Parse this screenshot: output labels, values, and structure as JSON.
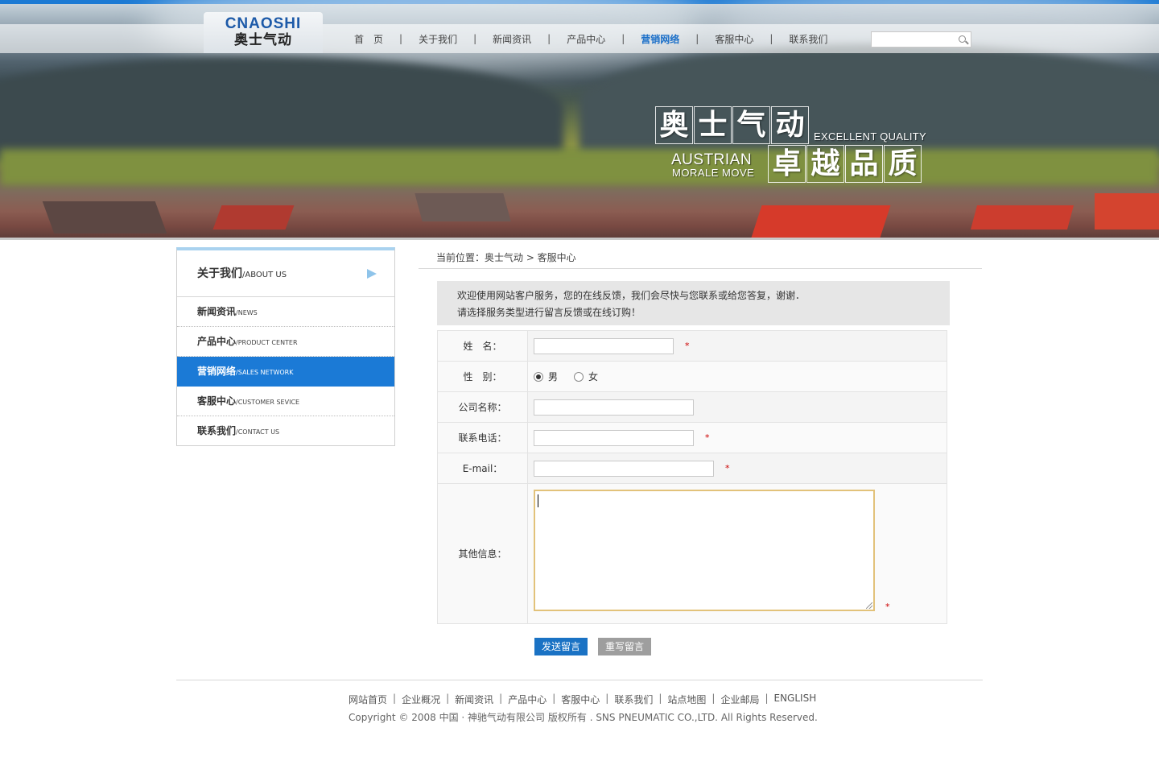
{
  "header": {
    "logo_en": "CNAOSHI",
    "logo_cn": "奥士气动",
    "nav": [
      {
        "label": "首　页",
        "active": false
      },
      {
        "label": "关于我们",
        "active": false
      },
      {
        "label": "新闻资讯",
        "active": false
      },
      {
        "label": "产品中心",
        "active": false
      },
      {
        "label": "营销网络",
        "active": true
      },
      {
        "label": "客服中心",
        "active": false
      },
      {
        "label": "联系我们",
        "active": false
      }
    ],
    "nav_separator": "|",
    "search_value": "",
    "search_icon": "search-icon",
    "accent_color": "#1b7ad6"
  },
  "banner": {
    "slogan_cn_1": [
      "奥",
      "士",
      "气",
      "动"
    ],
    "slogan_cn_2": [
      "卓",
      "越",
      "品",
      "质"
    ],
    "slogan_en_1": "EXCELLENT QUALITY",
    "slogan_en_2": "AUSTRIAN",
    "slogan_en_3": "MORALE MOVE"
  },
  "sidebar": {
    "title_cn": "关于我们",
    "title_en": "/ABOUT US",
    "items": [
      {
        "cn": "新闻资讯",
        "en": "/NEWS",
        "active": false
      },
      {
        "cn": "产品中心",
        "en": "/PRODUCT CENTER",
        "active": false
      },
      {
        "cn": "营销网络",
        "en": "/SALES NETWORK",
        "active": true
      },
      {
        "cn": "客服中心",
        "en": "/CUSTOMER SEVICE",
        "active": false
      },
      {
        "cn": "联系我们",
        "en": "/CONTACT US",
        "active": false
      }
    ]
  },
  "main": {
    "breadcrumb": "当前位置：奥士气动 > 客服中心",
    "notice_line1": "欢迎使用网站客户服务，您的在线反馈，我们会尽快与您联系或给您答复，谢谢．",
    "notice_line2": "请选择服务类型进行留言反馈或在线订购！",
    "form": {
      "name_label": "姓　名：",
      "name_value": "",
      "gender_label": "性　别：",
      "gender_male": "男",
      "gender_female": "女",
      "gender_selected": "男",
      "company_label": "公司名称：",
      "company_value": "",
      "phone_label": "联系电话：",
      "phone_value": "",
      "email_label": "E-mail：",
      "email_value": "",
      "other_label": "其他信息：",
      "other_value": "",
      "required_mark": "*"
    },
    "send_button": "发送留言",
    "reset_button": "重写留言"
  },
  "footer": {
    "links": [
      "网站首页",
      "企业概况",
      "新闻资讯",
      "产品中心",
      "客服中心",
      "联系我们",
      "站点地图",
      "企业邮局",
      "ENGLISH"
    ],
    "separator": "|",
    "copyright": "Copyright © 2008 中国 · 神驰气动有限公司 版权所有 . SNS PNEUMATIC CO.,LTD. All Rights Reserved."
  }
}
